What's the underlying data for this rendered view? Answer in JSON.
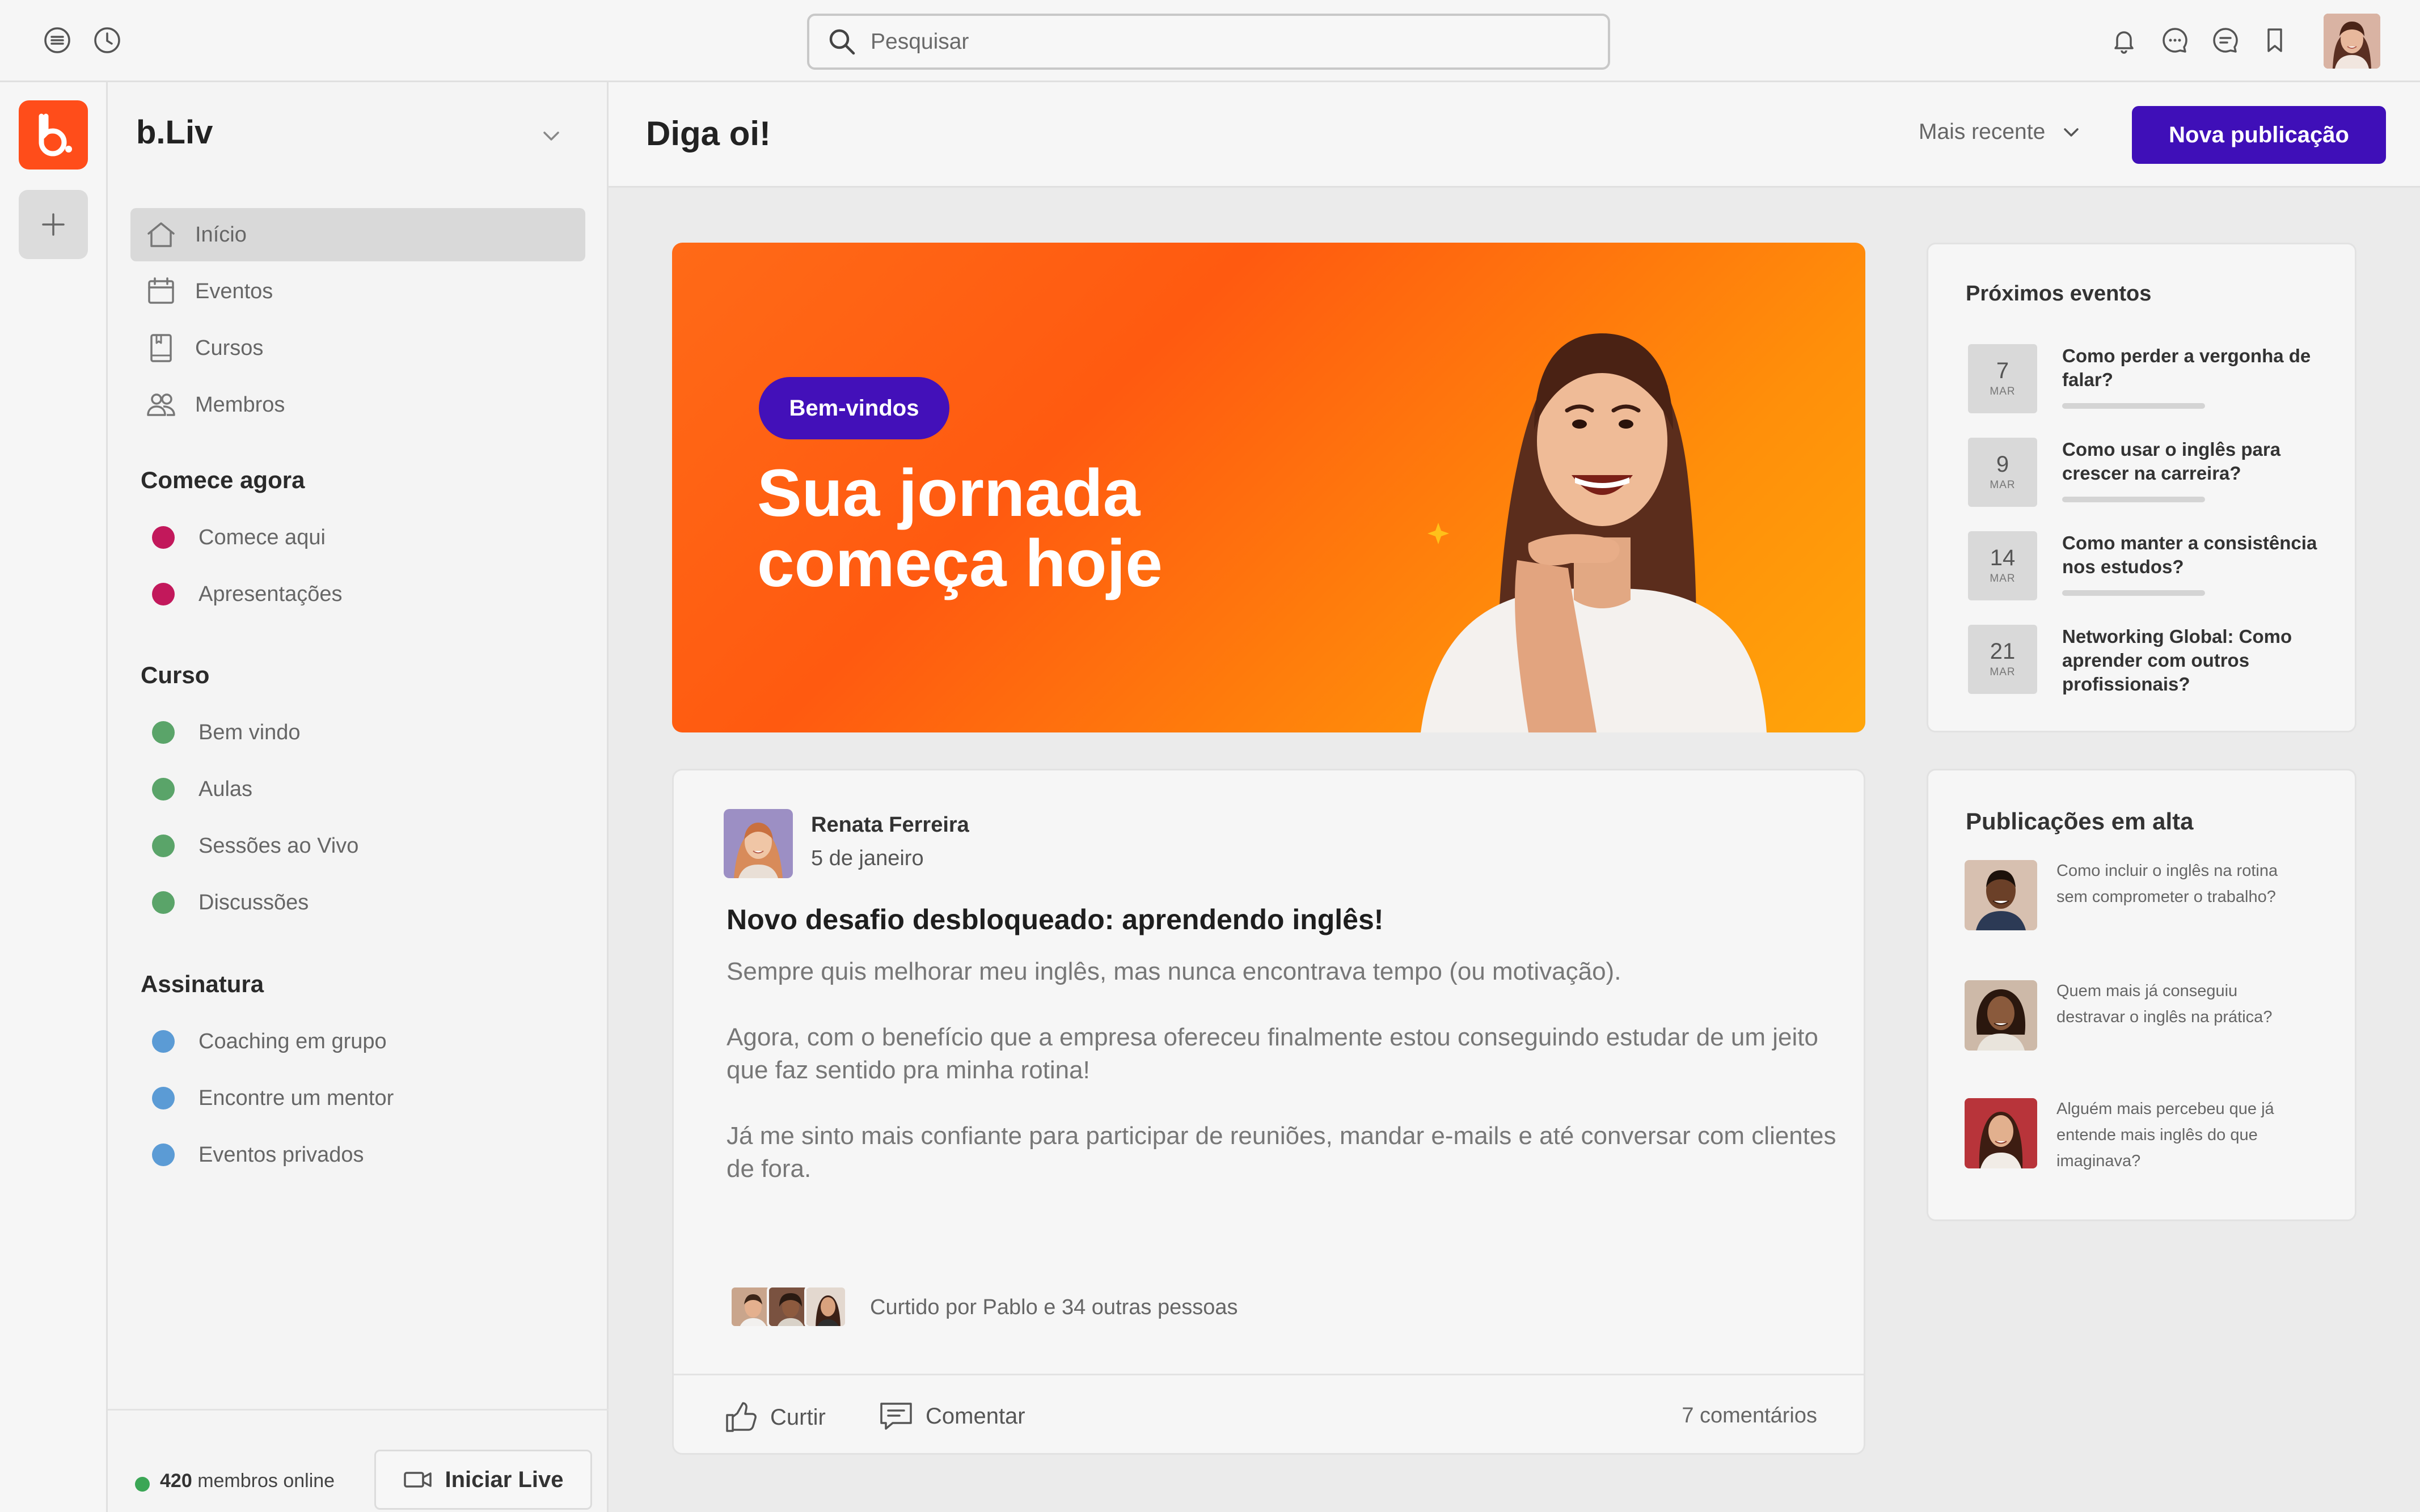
{
  "search": {
    "placeholder": "Pesquisar"
  },
  "community": {
    "name": "b.Liv"
  },
  "nav": [
    {
      "label": "Início",
      "icon": "home-icon",
      "active": true
    },
    {
      "label": "Eventos",
      "icon": "calendar-icon"
    },
    {
      "label": "Cursos",
      "icon": "book-icon"
    },
    {
      "label": "Membros",
      "icon": "members-icon"
    }
  ],
  "sections": [
    {
      "title": "Comece agora",
      "color": "#c2185b",
      "items": [
        "Comece aqui",
        "Apresentações"
      ]
    },
    {
      "title": "Curso",
      "color": "#5aa469",
      "items": [
        "Bem vindo",
        "Aulas",
        "Sessões ao Vivo",
        "Discussões"
      ]
    },
    {
      "title": "Assinatura",
      "color": "#5b9bd5",
      "items": [
        "Coaching em grupo",
        "Encontre um mentor",
        "Eventos privados"
      ]
    }
  ],
  "footer": {
    "online_count": "420",
    "online_label": "membros online",
    "live_label": "Iniciar Live"
  },
  "header": {
    "title": "Diga oi!",
    "sort_label": "Mais recente",
    "new_post_label": "Nova publicação"
  },
  "banner": {
    "pill": "Bem-vindos",
    "title_line1": "Sua jornada",
    "title_line2": "começa hoje"
  },
  "post": {
    "author": "Renata Ferreira",
    "date": "5 de janeiro",
    "title": "Novo desafio desbloqueado: aprendendo inglês!",
    "paragraphs": [
      "Sempre quis melhorar meu inglês, mas nunca encontrava tempo (ou motivação).",
      "Agora, com o benefício que a empresa ofereceu finalmente estou conseguindo estudar de um jeito que faz sentido pra minha rotina!",
      "Já me sinto mais confiante para participar de reuniões, mandar e-mails e até conversar com clientes de fora."
    ],
    "liked_by": "Curtido por Pablo e 34 outras pessoas",
    "like_label": "Curtir",
    "comment_label": "Comentar",
    "comments_count": "7 comentários"
  },
  "events": {
    "title": "Próximos eventos",
    "items": [
      {
        "day": "7",
        "month": "MAR",
        "title": "Como perder a vergonha de falar?"
      },
      {
        "day": "9",
        "month": "MAR",
        "title": "Como usar o inglês para crescer na carreira?"
      },
      {
        "day": "14",
        "month": "MAR",
        "title": "Como manter a consistência nos estudos?"
      },
      {
        "day": "21",
        "month": "MAR",
        "title": "Networking Global: Como aprender com outros profissionais?"
      }
    ]
  },
  "trending": {
    "title": "Publicações em alta",
    "items": [
      {
        "text": "Como incluir o inglês na rotina sem comprometer o trabalho?"
      },
      {
        "text": "Quem mais já conseguiu destravar o inglês na prática?"
      },
      {
        "text": "Alguém mais percebeu que já entende mais inglês do que imaginava?"
      }
    ]
  },
  "colors": {
    "accent": "#3f0fb8",
    "brand": "#ff4d1a",
    "online": "#3aa655"
  }
}
